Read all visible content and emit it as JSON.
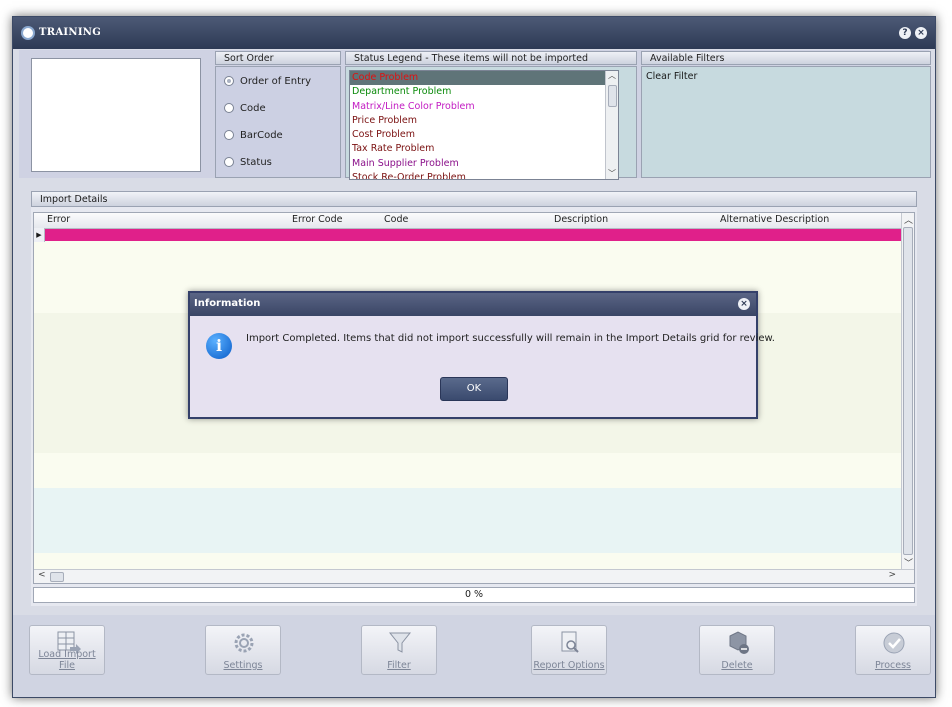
{
  "window": {
    "title": "TRAINING",
    "help_glyph": "?",
    "close_glyph": "×"
  },
  "sort_order": {
    "heading": "Sort Order",
    "options": [
      {
        "label": "Order of Entry",
        "checked": true
      },
      {
        "label": "Code",
        "checked": false
      },
      {
        "label": "BarCode",
        "checked": false
      },
      {
        "label": "Status",
        "checked": false
      }
    ]
  },
  "status_legend": {
    "heading": "Status Legend - These items will not be imported",
    "items": [
      {
        "label": "Code Problem",
        "color": "#e01010",
        "selected": true
      },
      {
        "label": "Department Problem",
        "color": "#0a8a0a"
      },
      {
        "label": "Matrix/Line Color Problem",
        "color": "#c21ac2"
      },
      {
        "label": "Price Problem",
        "color": "#7a1010"
      },
      {
        "label": "Cost Problem",
        "color": "#7a1010"
      },
      {
        "label": "Tax Rate Problem",
        "color": "#7a1010"
      },
      {
        "label": "Main Supplier Problem",
        "color": "#8a108a"
      },
      {
        "label": "Stock Re-Order Problem",
        "color": "#7a1010"
      }
    ]
  },
  "filters": {
    "heading": "Available Filters",
    "items": [
      "Clear Filter"
    ]
  },
  "import_details": {
    "heading": "Import Details",
    "columns": [
      "Error",
      "Error Code",
      "Code",
      "Description",
      "Alternative Description"
    ],
    "progress_text": "0 %"
  },
  "dialog": {
    "title": "Information",
    "message": "Import Completed. Items that did not import successfully will remain in the Import Details grid for review.",
    "ok_label": "OK",
    "icon_glyph": "i"
  },
  "footer": {
    "buttons": [
      "Load Import File",
      "Settings",
      "Filter",
      "Report Options",
      "Delete",
      "Process"
    ]
  }
}
